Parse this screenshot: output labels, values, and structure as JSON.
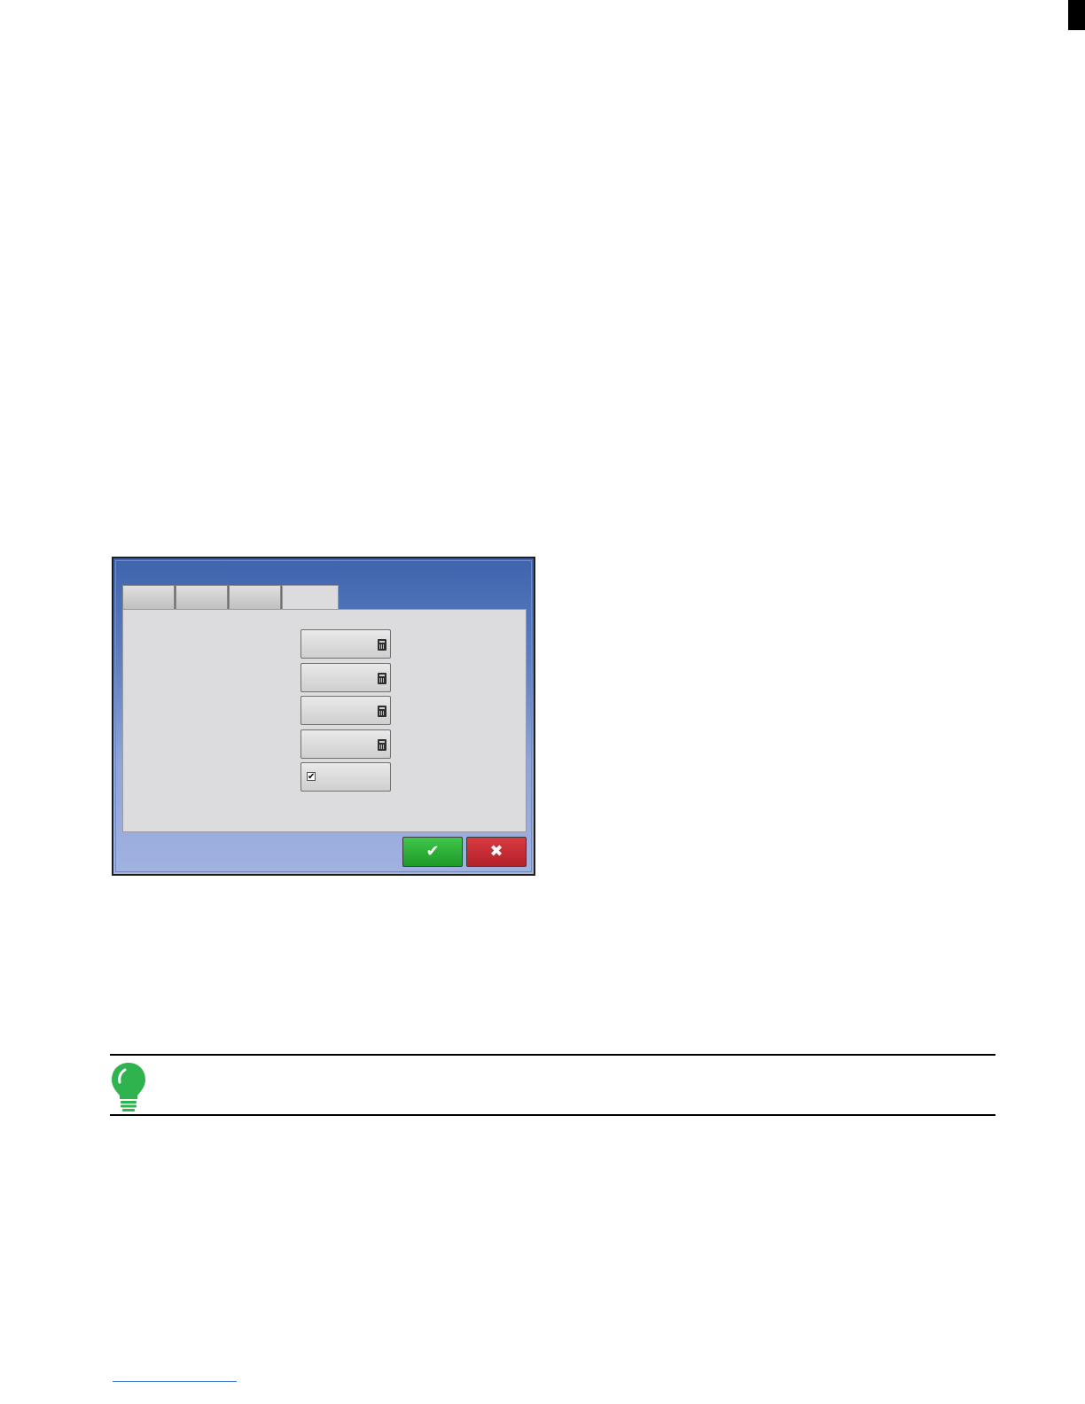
{
  "dialog": {
    "tabs": [
      "",
      "",
      "",
      ""
    ],
    "active_tab_index": 3,
    "fields": [
      {
        "type": "numeric",
        "icon": "calculator-icon",
        "value": ""
      },
      {
        "type": "numeric",
        "icon": "calculator-icon",
        "value": ""
      },
      {
        "type": "numeric",
        "icon": "calculator-icon",
        "value": ""
      },
      {
        "type": "numeric",
        "icon": "calculator-icon",
        "value": ""
      },
      {
        "type": "checkbox",
        "checked": true,
        "glyph": "✔"
      }
    ],
    "ok_button": {
      "icon": "checkmark-icon",
      "glyph": "✔",
      "color": "#2eb53a"
    },
    "cancel_button": {
      "icon": "close-icon",
      "glyph": "✖",
      "color": "#c62c33"
    },
    "colors": {
      "title_bar": "#3e63ac",
      "panel": "#dcdcdf"
    }
  },
  "tip": {
    "icon": "lightbulb-icon",
    "color": "#2fb34f"
  }
}
